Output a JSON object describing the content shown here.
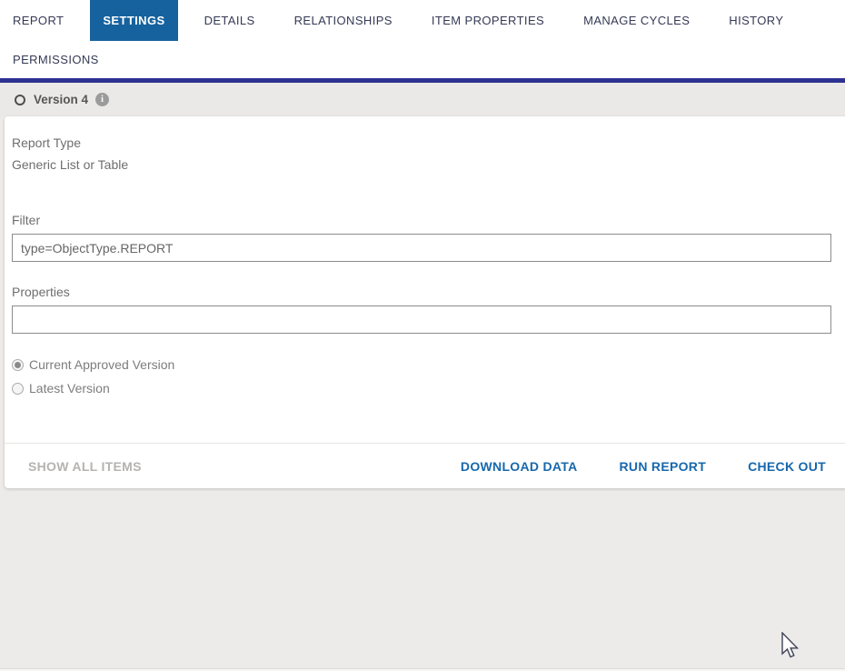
{
  "tabs": [
    {
      "label": "REPORT",
      "active": false
    },
    {
      "label": "SETTINGS",
      "active": true
    },
    {
      "label": "DETAILS",
      "active": false
    },
    {
      "label": "RELATIONSHIPS",
      "active": false
    },
    {
      "label": "ITEM PROPERTIES",
      "active": false
    },
    {
      "label": "MANAGE CYCLES",
      "active": false
    },
    {
      "label": "HISTORY",
      "active": false
    },
    {
      "label": "PERMISSIONS",
      "active": false
    }
  ],
  "version_bar": {
    "label": "Version 4",
    "info_glyph": "i"
  },
  "report_type": {
    "label": "Report Type",
    "value": "Generic List or Table"
  },
  "filter": {
    "label": "Filter",
    "value": "type=ObjectType.REPORT"
  },
  "properties": {
    "label": "Properties",
    "value": ""
  },
  "version_options": [
    {
      "label": "Current Approved Version",
      "selected": true
    },
    {
      "label": "Latest Version",
      "selected": false
    }
  ],
  "footer": {
    "show_all_items": "SHOW ALL ITEMS",
    "download_data": "DOWNLOAD DATA",
    "run_report": "RUN REPORT",
    "check_out": "CHECK OUT"
  },
  "colors": {
    "active_tab_bg": "#15629e",
    "navy_bar": "#2e3192",
    "action_link": "#1768ac",
    "page_bg": "#ecebe9"
  }
}
